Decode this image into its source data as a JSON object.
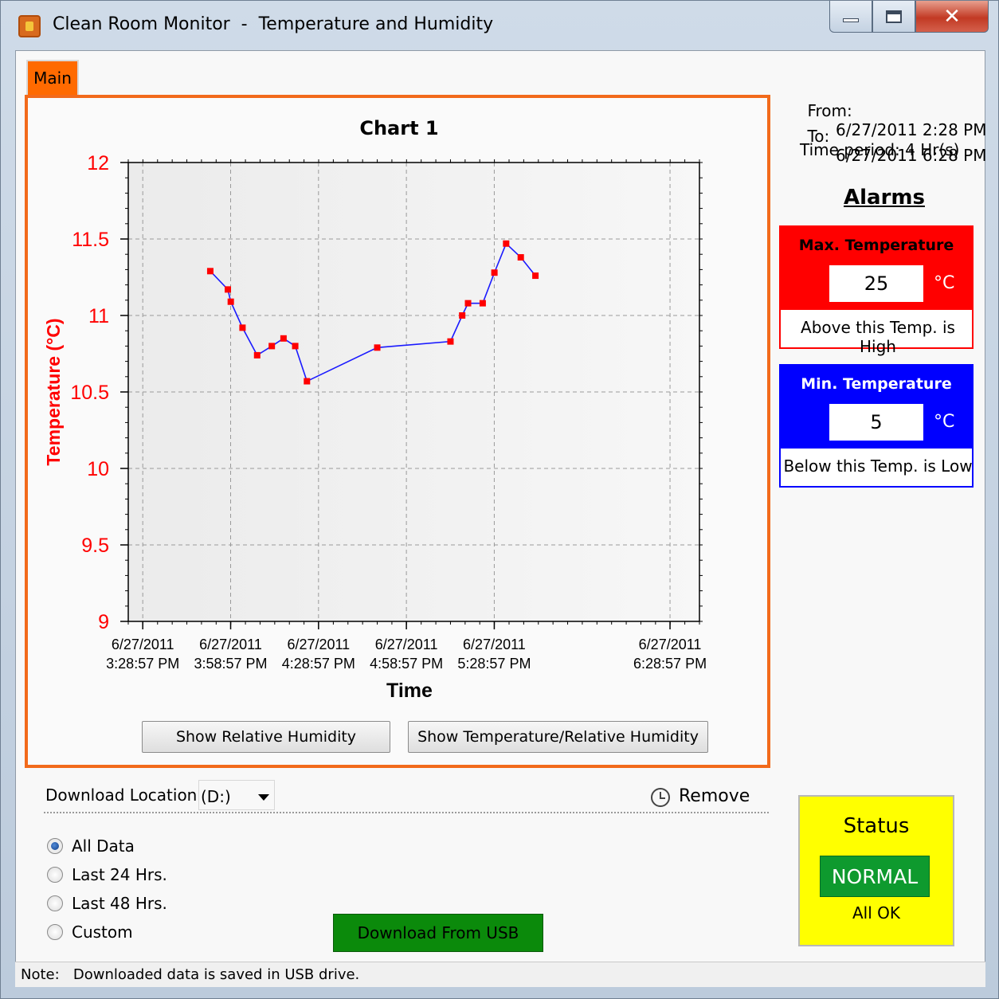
{
  "window": {
    "title": "Clean Room Monitor  -  Temperature and Humidity",
    "icons": {
      "app": "app-icon",
      "minimize": "minimize-icon",
      "maximize": "maximize-icon",
      "close": "close-icon"
    },
    "close_glyph": "✕"
  },
  "tabs": [
    {
      "label": "Main",
      "active": true,
      "color": "#ff6a00"
    }
  ],
  "chart": {
    "heading": "Chart 1",
    "xlabel": "Time",
    "ylabel": "Temperature (°C)"
  },
  "chart_data": {
    "type": "line",
    "title": "Chart 1",
    "xlabel": "Time",
    "ylabel": "Temperature (°C)",
    "ylim": [
      9,
      12
    ],
    "yticks": [
      "12",
      "11.5",
      "11",
      "10.5",
      "10",
      "9.5",
      "9"
    ],
    "xlim": [
      "2011-06-27T15:24:00",
      "2011-06-27T18:39:00"
    ],
    "xticks": [
      {
        "date": "6/27/2011",
        "time": "3:28:57 PM"
      },
      {
        "date": "6/27/2011",
        "time": "3:58:57 PM"
      },
      {
        "date": "6/27/2011",
        "time": "4:28:57 PM"
      },
      {
        "date": "6/27/2011",
        "time": "4:58:57 PM"
      },
      {
        "date": "6/27/2011",
        "time": "5:28:57 PM"
      },
      {
        "date": "6/27/2011",
        "time": "6:28:57 PM"
      }
    ],
    "grid": true,
    "colors": {
      "line": "#1a1aff",
      "marker": "#ff0000",
      "axis_text": "#ff0000"
    },
    "series": [
      {
        "points": [
          {
            "x": "2011-06-27T15:52:00",
            "y": 11.29
          },
          {
            "x": "2011-06-27T15:58:00",
            "y": 11.17
          },
          {
            "x": "2011-06-27T15:59:00",
            "y": 11.09
          },
          {
            "x": "2011-06-27T16:03:00",
            "y": 10.92
          },
          {
            "x": "2011-06-27T16:08:00",
            "y": 10.74
          },
          {
            "x": "2011-06-27T16:13:00",
            "y": 10.8
          },
          {
            "x": "2011-06-27T16:17:00",
            "y": 10.85
          },
          {
            "x": "2011-06-27T16:21:00",
            "y": 10.8
          },
          {
            "x": "2011-06-27T16:25:00",
            "y": 10.57
          },
          {
            "x": "2011-06-27T16:49:00",
            "y": 10.79
          },
          {
            "x": "2011-06-27T17:14:00",
            "y": 10.83
          },
          {
            "x": "2011-06-27T17:18:00",
            "y": 11.0
          },
          {
            "x": "2011-06-27T17:20:00",
            "y": 11.08
          },
          {
            "x": "2011-06-27T17:25:00",
            "y": 11.08
          },
          {
            "x": "2011-06-27T17:29:00",
            "y": 11.28
          },
          {
            "x": "2011-06-27T17:33:00",
            "y": 11.47
          },
          {
            "x": "2011-06-27T17:38:00",
            "y": 11.38
          },
          {
            "x": "2011-06-27T17:43:00",
            "y": 11.26
          }
        ]
      }
    ]
  },
  "buttons": {
    "show_rh": "Show Relative Humidity",
    "show_temp_rh": "Show Temperature/Relative Humidity",
    "download_usb": "Download From USB"
  },
  "range": {
    "from_label": "From:",
    "from_value": "6/27/2011 2:28 PM",
    "to_label": "To:",
    "to_value": "6/27/2011 6:28 PM",
    "period": "Time period: 4 Hr(s)"
  },
  "alarms": {
    "heading": "Alarms",
    "max": {
      "label": "Max. Temperature",
      "value": "25",
      "unit": "°C",
      "description": "Above this Temp. is High",
      "color": "#ff0000"
    },
    "min": {
      "label": "Min. Temperature",
      "value": "5",
      "unit": "°C",
      "description": "Below this Temp. is Low",
      "color": "#0000ff"
    }
  },
  "download": {
    "label": "Download Location",
    "location": "(D:)",
    "remove_label": "Remove",
    "options": [
      {
        "label": "All Data",
        "checked": true
      },
      {
        "label": "Last 24 Hrs.",
        "checked": false
      },
      {
        "label": "Last 48 Hrs.",
        "checked": false
      },
      {
        "label": "Custom",
        "checked": false
      }
    ]
  },
  "status": {
    "title": "Status",
    "state": "NORMAL",
    "note": "All OK",
    "colors": {
      "panel": "#ffff00",
      "badge": "#0e9a2e"
    }
  },
  "footer": {
    "note_label": "Note:",
    "note_text": "Downloaded data is saved in USB drive."
  }
}
